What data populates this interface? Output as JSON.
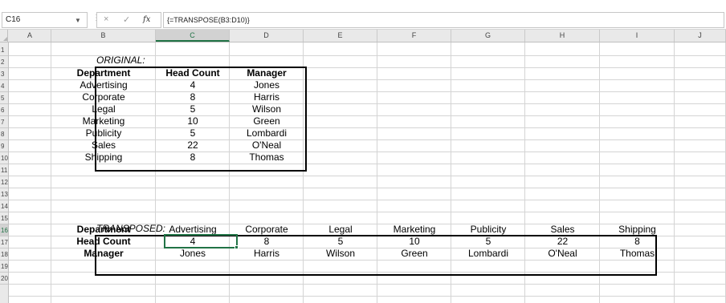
{
  "formula_bar": {
    "name_box": "C16",
    "cancel_icon": "×",
    "enter_icon": "✓",
    "fx_label": "fx",
    "formula": "{=TRANSPOSE(B3:D10)}"
  },
  "columns": [
    "A",
    "B",
    "C",
    "D",
    "E",
    "F",
    "G",
    "H",
    "I",
    "J"
  ],
  "rows": [
    "1",
    "2",
    "3",
    "4",
    "5",
    "6",
    "7",
    "8",
    "9",
    "10",
    "11",
    "12",
    "13",
    "14",
    "15",
    "16",
    "17",
    "18",
    "19",
    "20"
  ],
  "selected_column": "C",
  "selected_row": "16",
  "original": {
    "label": "ORIGINAL:",
    "headers": [
      "Department",
      "Head Count",
      "Manager"
    ],
    "rows": [
      [
        "Advertising",
        "4",
        "Jones"
      ],
      [
        "Corporate",
        "8",
        "Harris"
      ],
      [
        "Legal",
        "5",
        "Wilson"
      ],
      [
        "Marketing",
        "10",
        "Green"
      ],
      [
        "Publicity",
        "5",
        "Lombardi"
      ],
      [
        "Sales",
        "22",
        "O'Neal"
      ],
      [
        "Shipping",
        "8",
        "Thomas"
      ]
    ]
  },
  "transposed": {
    "label": "TRANSPOSED:",
    "rows": [
      [
        "Department",
        "Advertising",
        "Corporate",
        "Legal",
        "Marketing",
        "Publicity",
        "Sales",
        "Shipping"
      ],
      [
        "Head Count",
        "4",
        "8",
        "5",
        "10",
        "5",
        "22",
        "8"
      ],
      [
        "Manager",
        "Jones",
        "Harris",
        "Wilson",
        "Green",
        "Lombardi",
        "O'Neal",
        "Thomas"
      ]
    ]
  },
  "colors": {
    "accent": "#217346",
    "header_bg": "#e9e9e9",
    "gridline": "#d4d4d4"
  }
}
